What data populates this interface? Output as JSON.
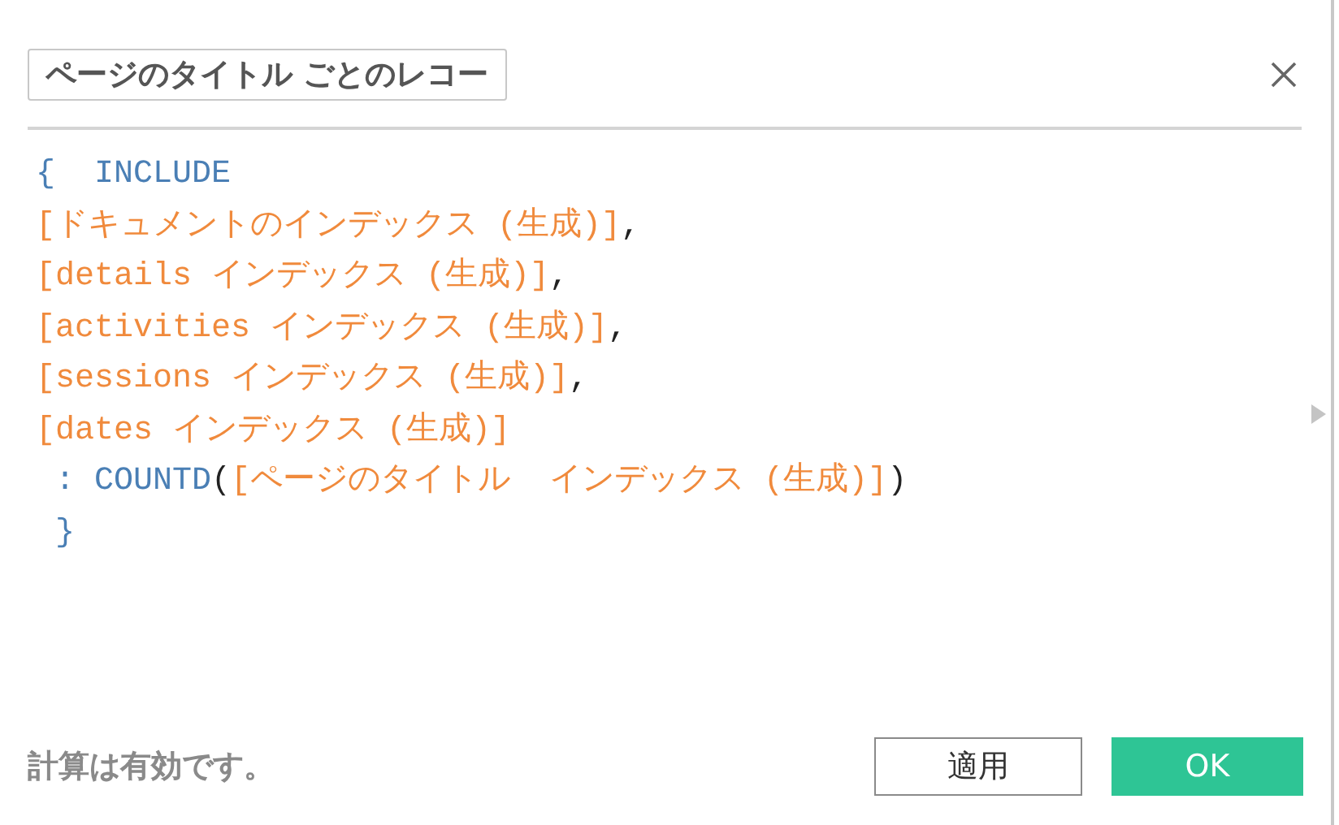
{
  "title_field": {
    "value": "ページのタイトル ごとのレコー"
  },
  "code_lines": [
    [
      {
        "kind": "keyword",
        "text": "{  INCLUDE"
      }
    ],
    [
      {
        "kind": "field",
        "text": "[ドキュメントのインデックス (生成)]"
      },
      {
        "kind": "punct",
        "text": ","
      }
    ],
    [
      {
        "kind": "field",
        "text": "[details インデックス (生成)]"
      },
      {
        "kind": "punct",
        "text": ","
      }
    ],
    [
      {
        "kind": "field",
        "text": "[activities インデックス (生成)]"
      },
      {
        "kind": "punct",
        "text": ","
      }
    ],
    [
      {
        "kind": "field",
        "text": "[sessions インデックス (生成)]"
      },
      {
        "kind": "punct",
        "text": ","
      }
    ],
    [
      {
        "kind": "field",
        "text": "[dates インデックス (生成)]"
      }
    ],
    [
      {
        "kind": "keyword",
        "text": " : COUNTD"
      },
      {
        "kind": "punct",
        "text": "("
      },
      {
        "kind": "field",
        "text": "[ページのタイトル  インデックス (生成)]"
      },
      {
        "kind": "punct",
        "text": ")"
      }
    ],
    [
      {
        "kind": "keyword",
        "text": " }"
      }
    ]
  ],
  "status": "計算は有効です。",
  "buttons": [
    {
      "kind": "secondary",
      "label": "適用"
    },
    {
      "kind": "primary",
      "label": "OK"
    }
  ]
}
